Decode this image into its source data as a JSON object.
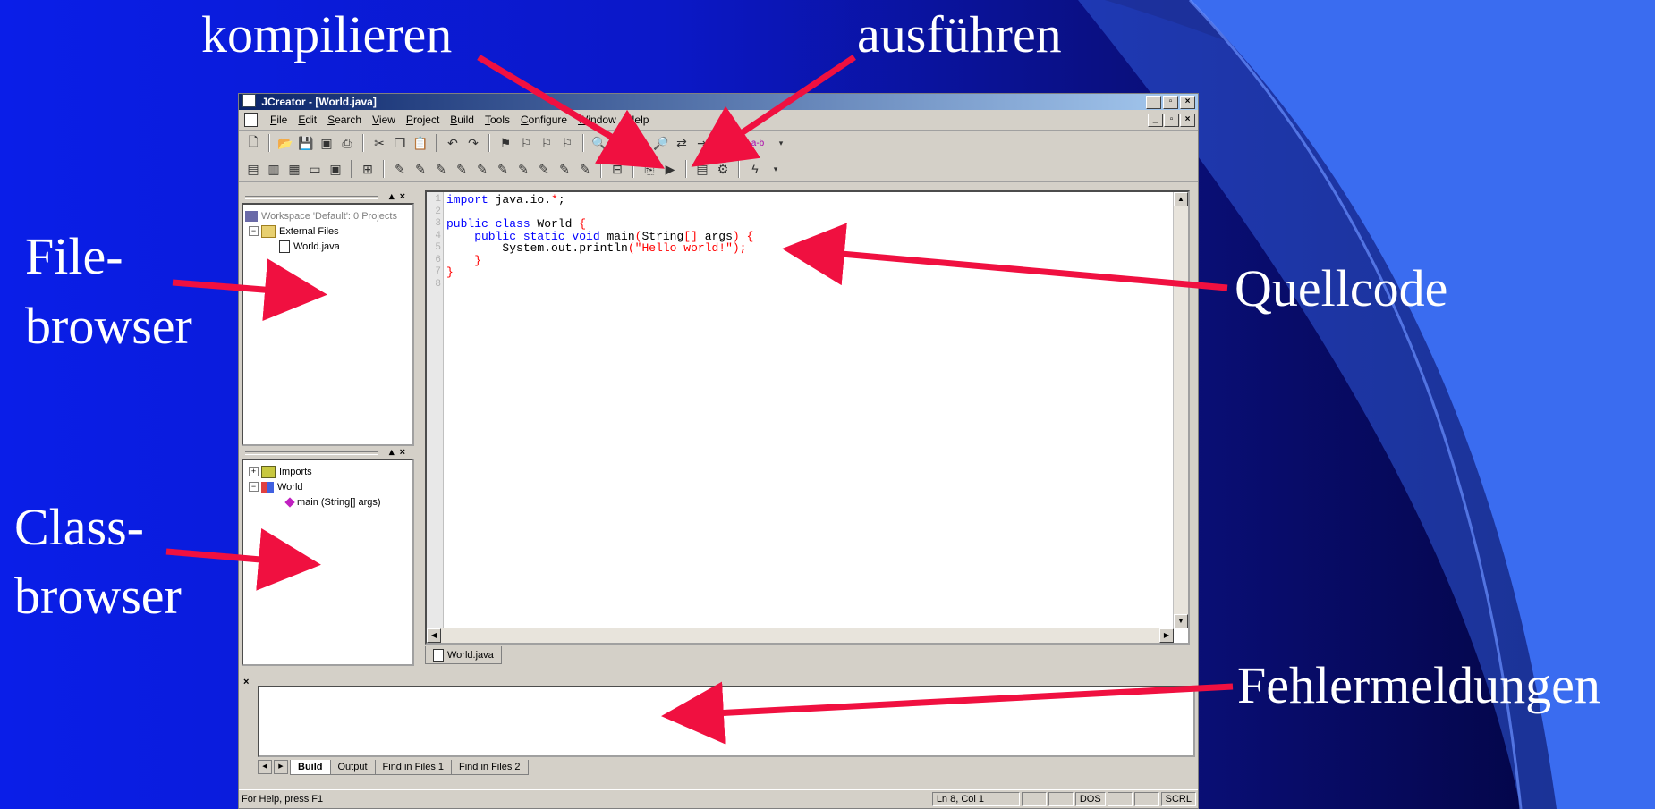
{
  "slide": {
    "labels": {
      "compile": "kompilieren",
      "run": "ausführen",
      "filebrowser_1": "File-",
      "filebrowser_2": "browser",
      "classbrowser_1": "Class-",
      "classbrowser_2": "browser",
      "source": "Quellcode",
      "errors": "Fehlermeldungen"
    },
    "colors": {
      "arrow": "#f01040",
      "label": "#ffffff",
      "curve_light": "#3a6cf0",
      "curve_dark": "#2b3fc0"
    }
  },
  "window": {
    "title": "JCreator - [World.java]",
    "menu": [
      "File",
      "Edit",
      "Search",
      "View",
      "Project",
      "Build",
      "Tools",
      "Configure",
      "Window",
      "Help"
    ],
    "toolbar1_icons": [
      "new-file-icon",
      "open-folder-icon",
      "save-icon",
      "save-all-icon",
      "print-icon",
      "cut-icon",
      "copy-icon",
      "paste-icon",
      "undo-icon",
      "redo-icon",
      "bookmark-icon",
      "bookmark-next-icon",
      "bookmark-prev-icon",
      "bookmark-clear-icon",
      "find-icon",
      "find-next-icon",
      "find-prev-icon",
      "find-in-files-icon",
      "replace-icon",
      "indent-icon",
      "outdent-icon"
    ],
    "toolbar1_text_button": "a-b",
    "toolbar2_icons": [
      "workspace-icon",
      "fileview-icon",
      "classview-icon",
      "output-icon",
      "browser-icon",
      "grid-icon",
      "tool1-icon",
      "tool2-icon",
      "tool3-icon",
      "tool4-icon",
      "tool5-icon",
      "tool6-icon",
      "tool7-icon",
      "tool8-icon",
      "tool9-icon",
      "tool10-icon",
      "compile-file-icon",
      "compile-project-icon",
      "execute-project-icon",
      "debug-icon",
      "step-icon",
      "jdk-icon"
    ],
    "workspace": {
      "root": "Workspace 'Default': 0 Projects",
      "folder": "External Files",
      "file": "World.java"
    },
    "classtree": {
      "imports": "Imports",
      "class": "World",
      "method": "main (String[] args)"
    },
    "code_lines": [
      {
        "n": "1",
        "parts": [
          {
            "t": "import",
            "c": "#0000ff"
          },
          {
            "t": " java.io.",
            "c": "#000000"
          },
          {
            "t": "*",
            "c": "#ff0000"
          },
          {
            "t": ";",
            "c": "#000000"
          }
        ]
      },
      {
        "n": "2",
        "parts": []
      },
      {
        "n": "3",
        "parts": [
          {
            "t": "public class",
            "c": "#0000ff"
          },
          {
            "t": " World ",
            "c": "#000000"
          },
          {
            "t": "{",
            "c": "#ff0000"
          }
        ]
      },
      {
        "n": "4",
        "parts": [
          {
            "t": "    public static void",
            "c": "#0000ff"
          },
          {
            "t": " main",
            "c": "#000000"
          },
          {
            "t": "(",
            "c": "#ff0000"
          },
          {
            "t": "String",
            "c": "#000000"
          },
          {
            "t": "[]",
            "c": "#ff0000"
          },
          {
            "t": " args",
            "c": "#000000"
          },
          {
            "t": ") {",
            "c": "#ff0000"
          }
        ]
      },
      {
        "n": "5",
        "parts": [
          {
            "t": "        System.out.println",
            "c": "#000000"
          },
          {
            "t": "(",
            "c": "#ff0000"
          },
          {
            "t": "\"Hello world!\"",
            "c": "#ff0000"
          },
          {
            "t": ");",
            "c": "#ff0000"
          }
        ]
      },
      {
        "n": "6",
        "parts": [
          {
            "t": "    }",
            "c": "#ff0000"
          }
        ]
      },
      {
        "n": "7",
        "parts": [
          {
            "t": "}",
            "c": "#ff0000"
          }
        ]
      },
      {
        "n": "8",
        "parts": []
      }
    ],
    "file_tab": "World.java",
    "output_tabs": [
      "Build",
      "Output",
      "Find in Files 1",
      "Find in Files 2"
    ],
    "status": {
      "help": "For Help, press F1",
      "position": "Ln 8, Col 1",
      "mode": "DOS",
      "scrl": "SCRL"
    }
  }
}
